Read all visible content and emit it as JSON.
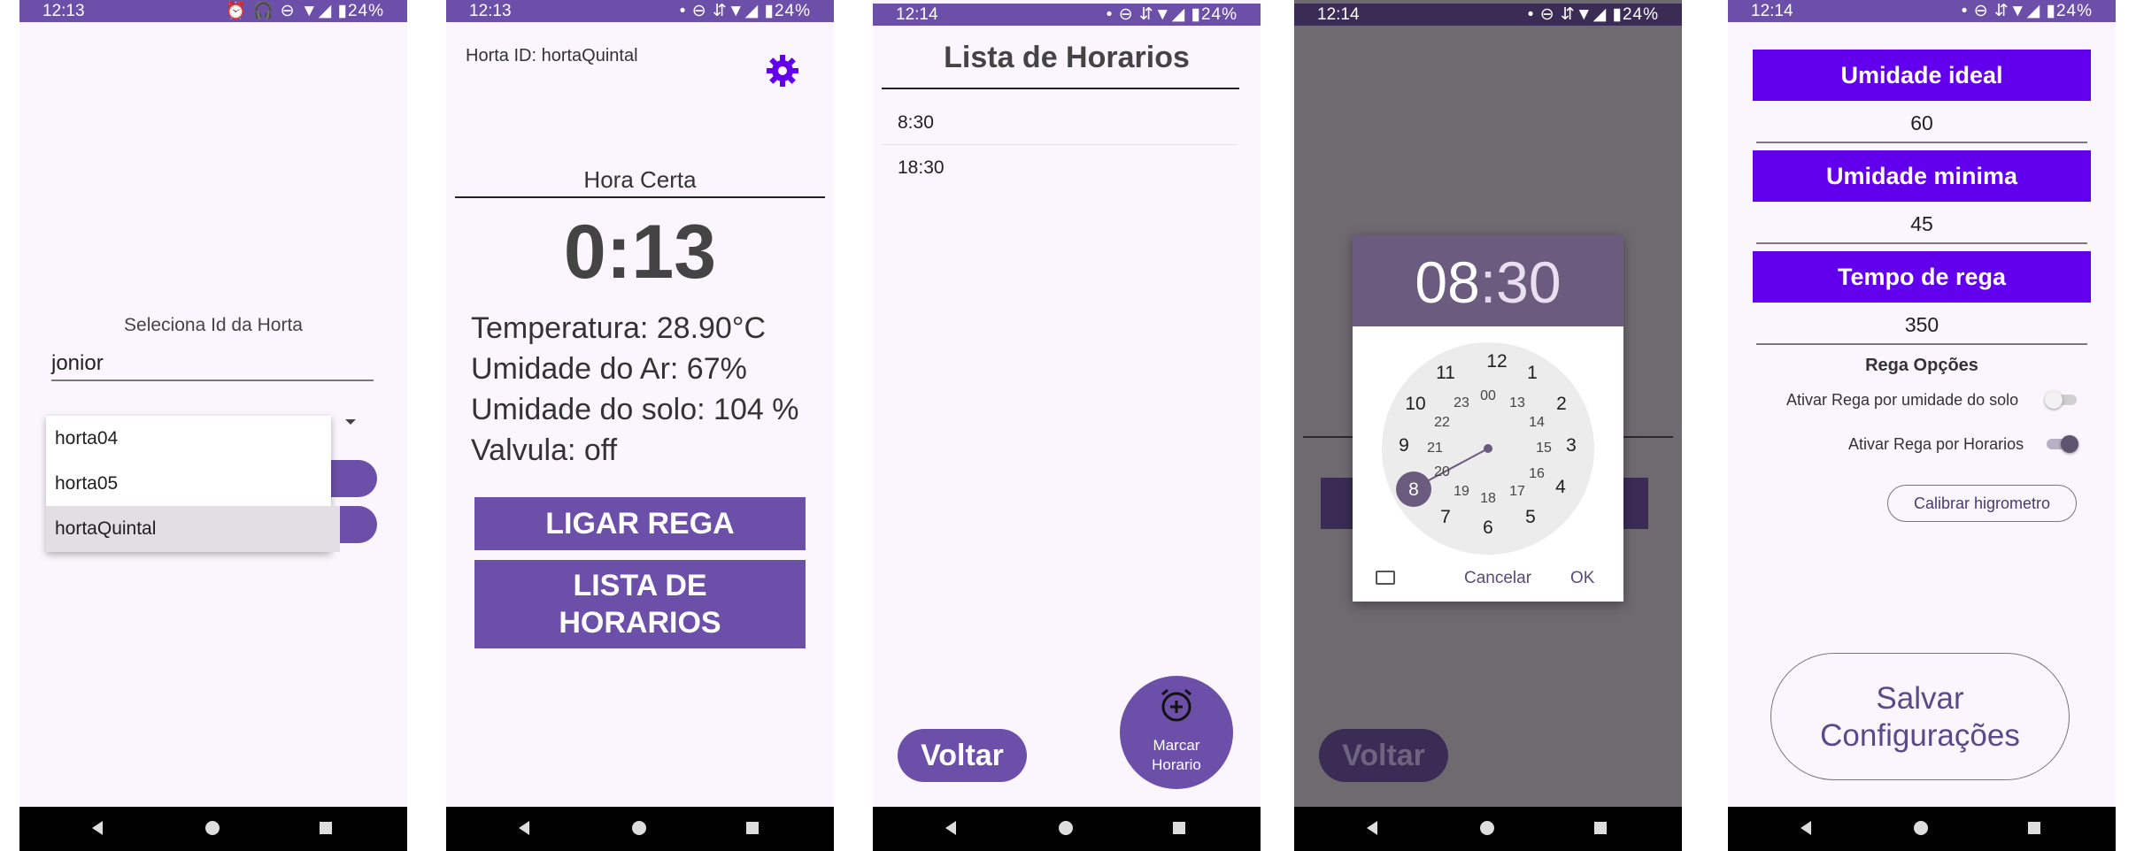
{
  "screens": [
    {
      "status": {
        "time": "12:13",
        "icons": "⏰ 🎧 ⊖ ▼◢ ▮24%"
      },
      "label": "Seleciona Id da Horta",
      "input_value": "jonior",
      "dropdown_items": [
        "horta04",
        "horta05",
        "hortaQuintal"
      ],
      "selected_item": "hortaQuintal"
    },
    {
      "status": {
        "time": "12:13",
        "icons": "• ⊖ ⇵▼◢ ▮24%"
      },
      "horta_id": "Horta ID: hortaQuintal",
      "hora_label": "Hora Certa",
      "clock": "0:13",
      "readings": [
        "Temperatura: 28.90°C",
        "Umidade do Ar: 67%",
        "Umidade do solo: 104 %",
        "Valvula: off"
      ],
      "btn_ligar": "LIGAR REGA",
      "btn_lista_line1": "LISTA DE",
      "btn_lista_line2": "HORARIOS"
    },
    {
      "status": {
        "time": "12:14",
        "icons": "• ⊖ ⇵▼◢ ▮24%"
      },
      "title": "Lista de Horarios",
      "times": [
        "8:30",
        "18:30"
      ],
      "btn_voltar": "Voltar",
      "fab_line1": "Marcar",
      "fab_line2": "Horario"
    },
    {
      "status": {
        "time": "12:14",
        "icons": "• ⊖ ⇵▼◢ ▮24%"
      },
      "picker_hour": "08",
      "picker_sep": ":",
      "picker_min": "30",
      "outer_numbers": [
        "12",
        "1",
        "2",
        "3",
        "4",
        "5",
        "6",
        "7",
        "8",
        "9",
        "10",
        "11"
      ],
      "inner_numbers": [
        "00",
        "13",
        "14",
        "15",
        "16",
        "17",
        "18",
        "19",
        "20",
        "21",
        "22",
        "23"
      ],
      "selected_hour": "8",
      "btn_cancel": "Cancelar",
      "btn_ok": "OK",
      "btn_voltar": "Voltar"
    },
    {
      "status": {
        "time": "12:14",
        "icons": "• ⊖ ⇵▼◢ ▮24%"
      },
      "umidade_ideal_label": "Umidade ideal",
      "umidade_ideal_value": "60",
      "umidade_minima_label": "Umidade minima",
      "umidade_minima_value": "45",
      "tempo_rega_label": "Tempo de rega",
      "tempo_rega_value": "350",
      "opcoes_title": "Rega Opções",
      "switch1_label": "Ativar Rega por umidade do solo",
      "switch1_on": false,
      "switch2_label": "Ativar Rega por Horarios",
      "switch2_on": true,
      "btn_calibrar": "Calibrar higrometro",
      "btn_salvar_line1": "Salvar",
      "btn_salvar_line2": "Configurações"
    }
  ],
  "colors": {
    "primary": "#6b4fa8",
    "violet": "#6200ee",
    "background": "#fbf6fd"
  }
}
